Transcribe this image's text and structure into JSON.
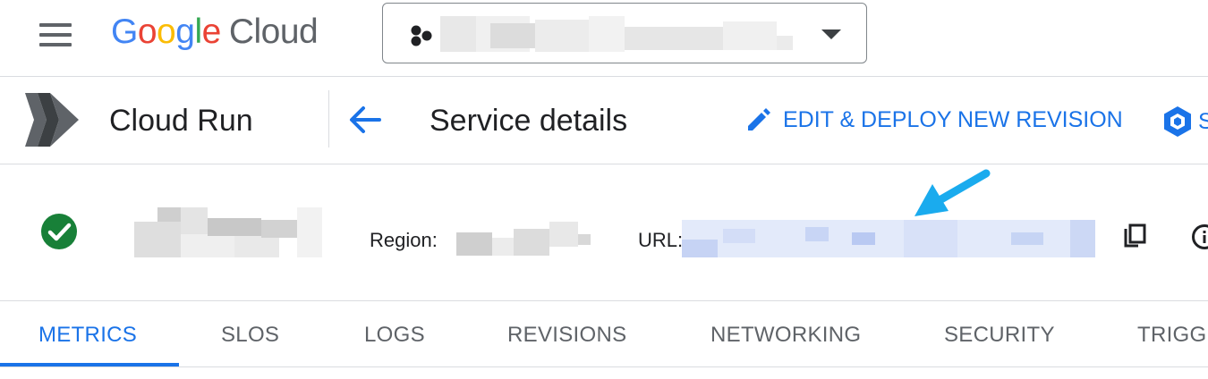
{
  "header": {
    "logo_google": "Google",
    "logo_cloud": "Cloud",
    "colors": {
      "blue": "#4285F4",
      "red": "#EA4335",
      "yellow": "#FBBC05",
      "green": "#34A853"
    }
  },
  "service_bar": {
    "product_name": "Cloud Run",
    "page_title": "Service details",
    "edit_label": "EDIT & DEPLOY NEW REVISION",
    "security_label_partial": "S"
  },
  "service_info": {
    "region_label": "Region:",
    "url_label": "URL:"
  },
  "tabs": [
    {
      "label": "METRICS",
      "active": true
    },
    {
      "label": "SLOS"
    },
    {
      "label": "LOGS"
    },
    {
      "label": "REVISIONS"
    },
    {
      "label": "NETWORKING"
    },
    {
      "label": "SECURITY"
    },
    {
      "label": "TRIGGERS"
    }
  ],
  "icons": [
    "menu-icon",
    "project-hex-icon",
    "dropdown-caret-icon",
    "cloud-run-logo-icon",
    "back-arrow-icon",
    "edit-pencil-icon",
    "security-icon",
    "status-ok-icon",
    "annotation-arrow-icon",
    "copy-icon",
    "info-icon"
  ],
  "accent_color": "#1a73e8"
}
